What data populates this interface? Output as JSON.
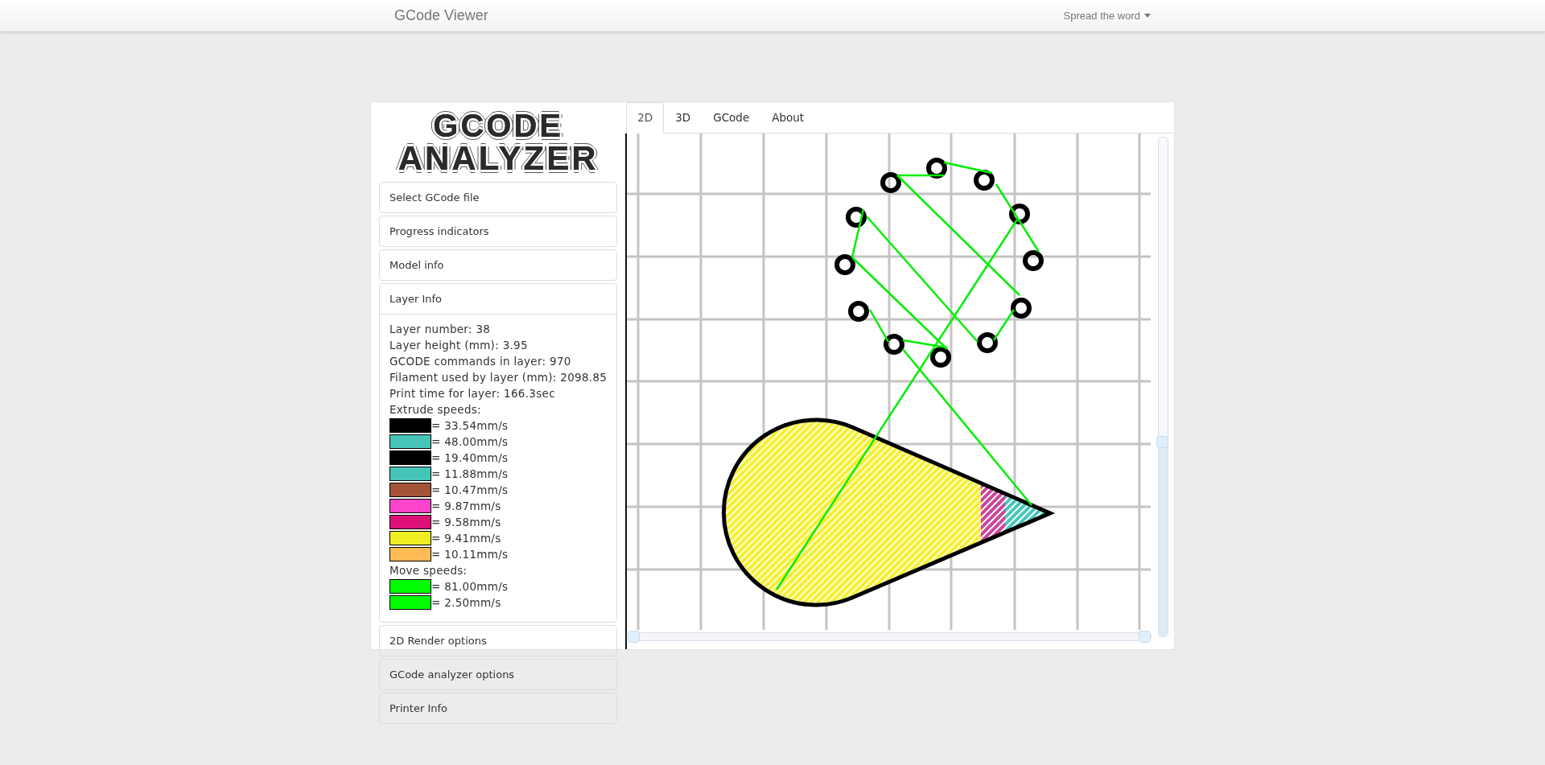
{
  "navbar": {
    "brand": "GCode Viewer",
    "menu": "Spread the word"
  },
  "logo": {
    "line_1": "GCODE",
    "line_2": "ANALYZER"
  },
  "panels": [
    {
      "title": "Select GCode file",
      "expanded": false
    },
    {
      "title": "Progress indicators",
      "expanded": false
    },
    {
      "title": "Model info",
      "expanded": false
    },
    {
      "title": "Layer Info",
      "expanded": true,
      "lines": [
        "Layer number: 38",
        "Layer height (mm): 3.95",
        "GCODE commands in layer: 970",
        "Filament used by layer (mm): 2098.85",
        "Print time for layer: 166.3sec"
      ],
      "extrude_label": "Extrude speeds:",
      "extrude_speeds": [
        {
          "color": "#000000",
          "text": "= 33.54mm/s"
        },
        {
          "color": "#45c6b8",
          "text": "= 48.00mm/s"
        },
        {
          "color": "#000000",
          "text": "= 19.40mm/s"
        },
        {
          "color": "#45c6b8",
          "text": "= 11.88mm/s"
        },
        {
          "color": "#a4533a",
          "text": "= 10.47mm/s"
        },
        {
          "color": "#ff44cc",
          "text": "= 9.87mm/s"
        },
        {
          "color": "#dd1177",
          "text": "= 9.58mm/s"
        },
        {
          "color": "#eeee22",
          "text": "= 9.41mm/s"
        },
        {
          "color": "#ffbb55",
          "text": "= 10.11mm/s"
        }
      ],
      "move_label": "Move speeds:",
      "move_speeds": [
        {
          "color": "#00ff00",
          "text": "= 81.00mm/s"
        },
        {
          "color": "#00ff00",
          "text": "= 2.50mm/s"
        }
      ]
    },
    {
      "title": "2D Render options",
      "expanded": false
    },
    {
      "title": "GCode analyzer options",
      "expanded": false
    },
    {
      "title": "Printer Info",
      "expanded": false
    }
  ],
  "tabs": [
    {
      "label": "2D",
      "selected": true
    },
    {
      "label": "3D",
      "selected": false
    },
    {
      "label": "GCode",
      "selected": false
    },
    {
      "label": "About",
      "selected": false
    }
  ],
  "layer_slider": {
    "level": 0.39
  },
  "range_slider": {
    "handles": [
      {
        "level": 0
      },
      {
        "level": 1
      }
    ]
  }
}
